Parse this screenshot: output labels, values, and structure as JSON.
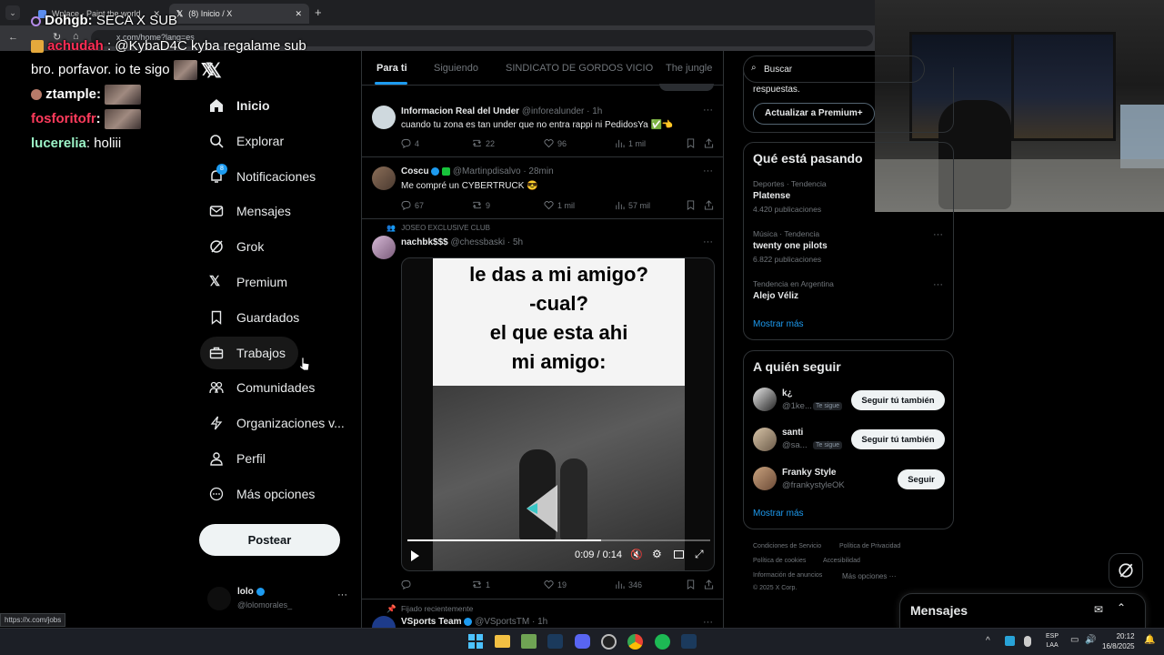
{
  "browser": {
    "tabs": [
      {
        "label": "Wplace - Paint the world"
      },
      {
        "label": "(8) Inicio / X"
      }
    ],
    "url": "x.com/home?lang=es",
    "status_url": "https://x.com/jobs"
  },
  "stream_chat": [
    {
      "user": "Dohgb",
      "user_color": "#ffffff",
      "message": "SECA X SUB"
    },
    {
      "user": "achudah",
      "user_color": "#ff2d55",
      "message": ": @KybaD4C kyba regalame sub"
    },
    {
      "user": "",
      "user_color": "#ffffff",
      "message": "bro. porfavor. io te sigo"
    },
    {
      "user": "ztample",
      "user_color": "#ffffff",
      "message": ":"
    },
    {
      "user": "fosforitofr",
      "user_color": "#ff3b5c",
      "message": ":"
    },
    {
      "user": "lucerelia",
      "user_color": "#9cf3c7",
      "message": ": holiii"
    }
  ],
  "nav": {
    "items": [
      {
        "label": "Inicio",
        "icon": "home-icon"
      },
      {
        "label": "Explorar",
        "icon": "search-icon"
      },
      {
        "label": "Notificaciones",
        "icon": "bell-icon",
        "badge": "8"
      },
      {
        "label": "Mensajes",
        "icon": "mail-icon"
      },
      {
        "label": "Grok",
        "icon": "grok-icon"
      },
      {
        "label": "Premium",
        "icon": "x-logo-icon"
      },
      {
        "label": "Guardados",
        "icon": "bookmark-icon"
      },
      {
        "label": "Trabajos",
        "icon": "briefcase-icon"
      },
      {
        "label": "Comunidades",
        "icon": "people-icon"
      },
      {
        "label": "Organizaciones v...",
        "icon": "lightning-icon"
      },
      {
        "label": "Perfil",
        "icon": "person-icon"
      },
      {
        "label": "Más opciones",
        "icon": "more-circle-icon"
      }
    ],
    "post_button": "Postear",
    "account": {
      "name": "lolo",
      "handle": "@lolomorales_"
    }
  },
  "main": {
    "tabs": [
      "Para ti",
      "Siguiendo",
      "SINDICATO DE GORDOS VICIO",
      "The jungle"
    ],
    "tweets": [
      {
        "name": "Informacion Real del Under",
        "handle": "@inforealunder",
        "time": "· 1h",
        "text": "cuando tu zona es tan under que no entra rappi ni PedidosYa ✅👈",
        "replies": "4",
        "reposts": "22",
        "likes": "96",
        "views": "1 mil"
      },
      {
        "name": "Coscu",
        "handle": "@Martinpdisalvo",
        "time": "· 28min",
        "text": "Me compré un CYBERTRUCK 😎",
        "replies": "67",
        "reposts": "9",
        "likes": "1 mil",
        "views": "57 mil"
      },
      {
        "context": "JOSEO EXCLUSIVE CLUB",
        "name": "nachbk$$$",
        "handle": "@chessbaski",
        "time": "· 5h",
        "video": {
          "caption_lines": [
            "le das a mi amigo?",
            "-cual?",
            "el que esta ahi",
            "mi amigo:"
          ],
          "time": "0:09 / 0:14",
          "progress": 0.64
        },
        "replies": "",
        "reposts": "1",
        "likes": "19",
        "views": "346"
      },
      {
        "context": "Fijado recientemente",
        "name": "VSports Team",
        "handle": "@VSportsTM",
        "time": "· 1h"
      }
    ]
  },
  "right": {
    "search_placeholder": "Buscar",
    "premium_text": "respuestas.",
    "premium_button": "Actualizar a Premium+",
    "trends_title": "Qué está pasando",
    "trends": [
      {
        "meta": "Deportes · Tendencia",
        "name": "Platense",
        "count": "4.420 publicaciones"
      },
      {
        "meta": "Música · Tendencia",
        "name": "twenty one pilots",
        "count": "6.822 publicaciones"
      },
      {
        "meta": "Tendencia en Argentina",
        "name": "Alejo Véliz",
        "count": ""
      }
    ],
    "trends_more": "Mostrar más",
    "follow_title": "A quién seguir",
    "suggestions": [
      {
        "name": "k¿",
        "handle": "@1ke...",
        "tag": "Te sigue",
        "button": "Seguir tú también"
      },
      {
        "name": "santi",
        "handle": "@sa...",
        "tag": "Te sigue",
        "button": "Seguir tú también"
      },
      {
        "name": "Franky Style",
        "handle": "@frankystyleOK",
        "tag": "",
        "button": "Seguir"
      }
    ],
    "follow_more": "Mostrar más",
    "footer": [
      "Condiciones de Servicio",
      "Política de Privacidad",
      "Política de cookies",
      "Accesibilidad",
      "Información de anuncios",
      "Más opciones ···",
      "© 2025 X Corp."
    ]
  },
  "messages_drawer": {
    "title": "Mensajes"
  },
  "taskbar": {
    "lang_top": "ESP",
    "lang_bottom": "LAA",
    "time": "20:12",
    "date": "16/8/2025"
  },
  "colors": {
    "accent": "#1d9bf0",
    "verified": "#1d9bf0",
    "border": "#2f3336",
    "muted": "#71767b"
  }
}
